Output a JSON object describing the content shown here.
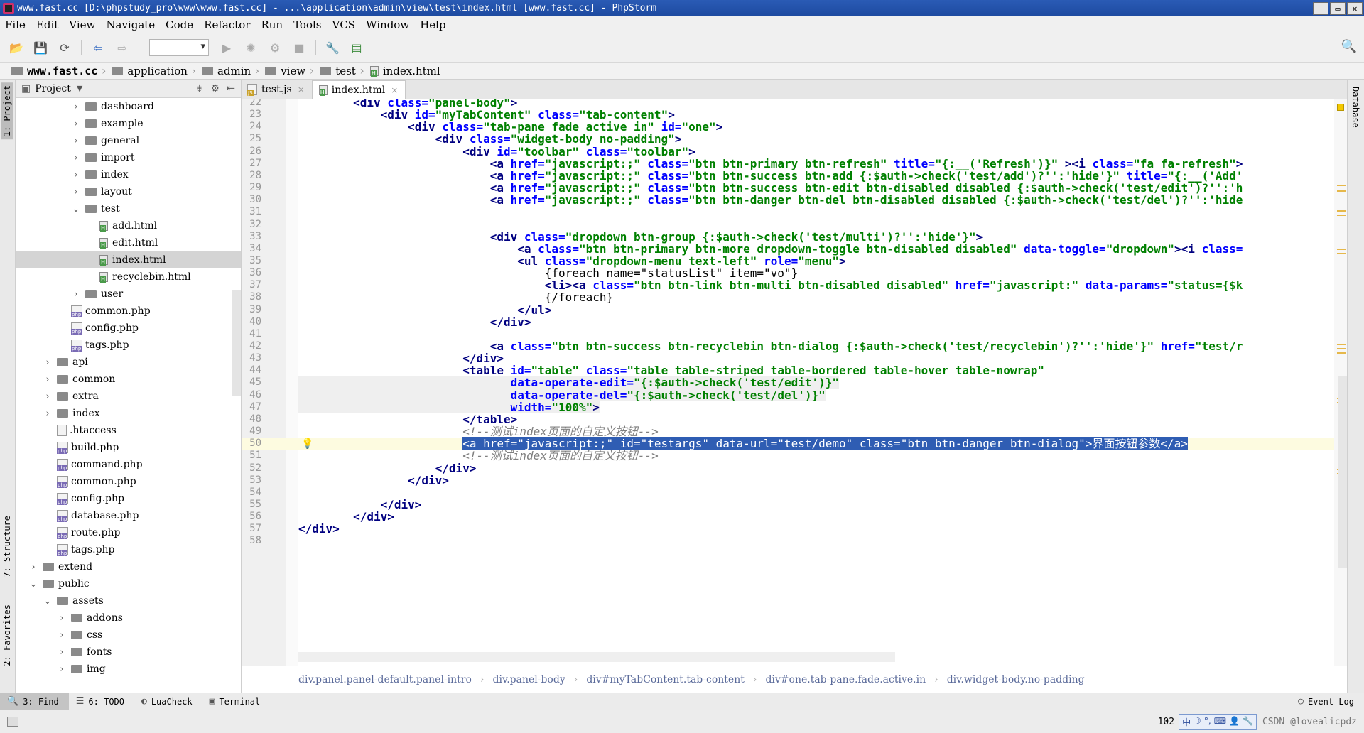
{
  "window": {
    "title": "www.fast.cc [D:\\phpstudy_pro\\www\\www.fast.cc] - ...\\application\\admin\\view\\test\\index.html [www.fast.cc] - PhpStorm",
    "min": "_",
    "max": "▭",
    "close": "✕"
  },
  "menu": [
    "File",
    "Edit",
    "View",
    "Navigate",
    "Code",
    "Refactor",
    "Run",
    "Tools",
    "VCS",
    "Window",
    "Help"
  ],
  "breadcrumbs": [
    "www.fast.cc",
    "application",
    "admin",
    "view",
    "test",
    "index.html"
  ],
  "project_panel": {
    "title": "Project",
    "tree": [
      {
        "label": "dashboard",
        "kind": "folder",
        "depth": 4,
        "expanded": false
      },
      {
        "label": "example",
        "kind": "folder",
        "depth": 4,
        "expanded": false
      },
      {
        "label": "general",
        "kind": "folder",
        "depth": 4,
        "expanded": false
      },
      {
        "label": "import",
        "kind": "folder",
        "depth": 4,
        "expanded": false
      },
      {
        "label": "index",
        "kind": "folder",
        "depth": 4,
        "expanded": false
      },
      {
        "label": "layout",
        "kind": "folder",
        "depth": 4,
        "expanded": false
      },
      {
        "label": "test",
        "kind": "folder",
        "depth": 4,
        "expanded": true
      },
      {
        "label": "add.html",
        "kind": "html",
        "depth": 5
      },
      {
        "label": "edit.html",
        "kind": "html",
        "depth": 5
      },
      {
        "label": "index.html",
        "kind": "html",
        "depth": 5,
        "selected": true
      },
      {
        "label": "recyclebin.html",
        "kind": "html",
        "depth": 5
      },
      {
        "label": "user",
        "kind": "folder",
        "depth": 4,
        "expanded": false
      },
      {
        "label": "common.php",
        "kind": "php",
        "depth": 3
      },
      {
        "label": "config.php",
        "kind": "php",
        "depth": 3
      },
      {
        "label": "tags.php",
        "kind": "php",
        "depth": 3
      },
      {
        "label": "api",
        "kind": "folder",
        "depth": 2,
        "expanded": false
      },
      {
        "label": "common",
        "kind": "folder",
        "depth": 2,
        "expanded": false
      },
      {
        "label": "extra",
        "kind": "folder",
        "depth": 2,
        "expanded": false
      },
      {
        "label": "index",
        "kind": "folder",
        "depth": 2,
        "expanded": false
      },
      {
        "label": ".htaccess",
        "kind": "plain",
        "depth": 2
      },
      {
        "label": "build.php",
        "kind": "php",
        "depth": 2
      },
      {
        "label": "command.php",
        "kind": "php",
        "depth": 2
      },
      {
        "label": "common.php",
        "kind": "php",
        "depth": 2
      },
      {
        "label": "config.php",
        "kind": "php",
        "depth": 2
      },
      {
        "label": "database.php",
        "kind": "php",
        "depth": 2
      },
      {
        "label": "route.php",
        "kind": "php",
        "depth": 2
      },
      {
        "label": "tags.php",
        "kind": "php",
        "depth": 2
      },
      {
        "label": "extend",
        "kind": "folder",
        "depth": 1,
        "expanded": false
      },
      {
        "label": "public",
        "kind": "folder",
        "depth": 1,
        "expanded": true
      },
      {
        "label": "assets",
        "kind": "folder",
        "depth": 2,
        "expanded": true
      },
      {
        "label": "addons",
        "kind": "folder",
        "depth": 3,
        "expanded": false
      },
      {
        "label": "css",
        "kind": "folder",
        "depth": 3,
        "expanded": false
      },
      {
        "label": "fonts",
        "kind": "folder",
        "depth": 3,
        "expanded": false
      },
      {
        "label": "img",
        "kind": "folder",
        "depth": 3,
        "expanded": false
      }
    ]
  },
  "left_tabs": [
    "1: Project",
    "7: Structure",
    "2: Favorites"
  ],
  "right_tabs": [
    "Database"
  ],
  "editor_tabs": [
    {
      "label": "test.js",
      "kind": "js",
      "active": false
    },
    {
      "label": "index.html",
      "kind": "html",
      "active": true
    }
  ],
  "code_lines": [
    {
      "n": "22",
      "html": "        <span class='tag'>&lt;div</span> <span class='attr'>class=</span><span class='val'>\"panel-body\"</span><span class='tag'>&gt;</span>"
    },
    {
      "n": "23",
      "html": "            <span class='tag'>&lt;div</span> <span class='attr'>id=</span><span class='val'>\"myTabContent\"</span> <span class='attr'>class=</span><span class='val'>\"tab-content\"</span><span class='tag'>&gt;</span>"
    },
    {
      "n": "24",
      "html": "                <span class='tag'>&lt;div</span> <span class='attr'>class=</span><span class='val'>\"tab-pane fade active in\"</span> <span class='attr'>id=</span><span class='val'>\"one\"</span><span class='tag'>&gt;</span>"
    },
    {
      "n": "25",
      "html": "                    <span class='tag'>&lt;div</span> <span class='attr'>class=</span><span class='val'>\"widget-body no-padding\"</span><span class='tag'>&gt;</span>"
    },
    {
      "n": "26",
      "html": "                        <span class='tag'>&lt;div</span> <span class='attr'>id=</span><span class='val'>\"toolbar\"</span> <span class='attr'>class=</span><span class='val'>\"toolbar\"</span><span class='tag'>&gt;</span>"
    },
    {
      "n": "27",
      "html": "                            <span class='tag'>&lt;a</span> <span class='attr'>href=</span><span class='val'>\"javascript:;\"</span> <span class='attr'>class=</span><span class='val'>\"btn btn-primary btn-refresh\"</span> <span class='attr'>title=</span><span class='val'>\"{:__('Refresh')}\"</span> <span class='tag'>&gt;&lt;i</span> <span class='attr'>class=</span><span class='val'>\"fa fa-refresh\"</span><span class='tag'>&gt;</span>"
    },
    {
      "n": "28",
      "html": "                            <span class='tag'>&lt;a</span> <span class='attr'>href=</span><span class='val'>\"javascript:;\"</span> <span class='attr'>class=</span><span class='val'>\"btn btn-success btn-add {:$auth-&gt;check('test/add')?'':'hide'}\"</span> <span class='attr'>title=</span><span class='val'>\"{:__('Add'</span>"
    },
    {
      "n": "29",
      "html": "                            <span class='tag'>&lt;a</span> <span class='attr'>href=</span><span class='val'>\"javascript:;\"</span> <span class='attr'>class=</span><span class='val'>\"btn btn-success btn-edit btn-disabled disabled {:$auth-&gt;check('test/edit')?'':'h</span>"
    },
    {
      "n": "30",
      "html": "                            <span class='tag'>&lt;a</span> <span class='attr'>href=</span><span class='val'>\"javascript:;\"</span> <span class='attr'>class=</span><span class='val'>\"btn btn-danger btn-del btn-disabled disabled {:$auth-&gt;check('test/del')?'':'hide</span>"
    },
    {
      "n": "31",
      "html": ""
    },
    {
      "n": "32",
      "html": ""
    },
    {
      "n": "33",
      "html": "                            <span class='tag'>&lt;div</span> <span class='attr'>class=</span><span class='val'>\"dropdown btn-group {:$auth-&gt;check('test/multi')?'':'hide'}\"</span><span class='tag'>&gt;</span>"
    },
    {
      "n": "34",
      "html": "                                <span class='tag'>&lt;a</span> <span class='attr'>class=</span><span class='val'>\"btn btn-primary btn-more dropdown-toggle btn-disabled disabled\"</span> <span class='attr'>data-toggle=</span><span class='val'>\"dropdown\"</span><span class='tag'>&gt;&lt;i</span> <span class='attr'>class=</span>"
    },
    {
      "n": "35",
      "html": "                                <span class='tag'>&lt;ul</span> <span class='attr'>class=</span><span class='val'>\"dropdown-menu text-left\"</span> <span class='attr'>role=</span><span class='val'>\"menu\"</span><span class='tag'>&gt;</span>"
    },
    {
      "n": "36",
      "html": "                                    <span class='tpl'>{foreach name=\"statusList\" item=\"vo\"}</span>"
    },
    {
      "n": "37",
      "html": "                                    <span class='tag'>&lt;li&gt;&lt;a</span> <span class='attr'>class=</span><span class='val'>\"btn btn-link btn-multi btn-disabled disabled\"</span> <span class='attr'>href=</span><span class='val'>\"javascript:\"</span> <span class='attr'>data-params=</span><span class='val'>\"status={$k</span>"
    },
    {
      "n": "38",
      "html": "                                    <span class='tpl'>{/foreach}</span>"
    },
    {
      "n": "39",
      "html": "                                <span class='tag'>&lt;/ul&gt;</span>"
    },
    {
      "n": "40",
      "html": "                            <span class='tag'>&lt;/div&gt;</span>"
    },
    {
      "n": "41",
      "html": ""
    },
    {
      "n": "42",
      "html": "                            <span class='tag'>&lt;a</span> <span class='attr'>class=</span><span class='val'>\"btn btn-success btn-recyclebin btn-dialog {:$auth-&gt;check('test/recyclebin')?'':'hide'}\"</span> <span class='attr'>href=</span><span class='val'>\"test/r</span>"
    },
    {
      "n": "43",
      "html": "                        <span class='tag'>&lt;/div&gt;</span>"
    },
    {
      "n": "44",
      "html": "                        <span class='tag'>&lt;table</span> <span class='attr'>id=</span><span class='val'>\"table\"</span> <span class='attr'>class=</span><span class='val'>\"table table-striped table-bordered table-hover table-nowrap\"</span>"
    },
    {
      "n": "45",
      "html": "                               <span class='attr'>data-operate-edit=</span><span class='val'>\"{:$auth-&gt;check('test/edit')}\"</span>"
    },
    {
      "n": "46",
      "html": "                               <span class='attr'>data-operate-del=</span><span class='val'>\"{:$auth-&gt;check('test/del')}\"</span>"
    },
    {
      "n": "47",
      "html": "                               <span class='attr'>width=</span><span class='val'>\"100%\"</span><span class='tag'>&gt;</span>"
    },
    {
      "n": "48",
      "html": "                        <span class='tag'>&lt;/table&gt;</span>"
    },
    {
      "n": "49",
      "html": "                        <span class='cmt'>&lt;!--测试index页面的自定义按钮--&gt;</span>"
    },
    {
      "n": "50",
      "html": "                        <span class='sel'>&lt;a href=\"javascript:;\" id=\"testargs\" data-url=\"test/demo\" class=\"btn btn-danger btn-dialog\"&gt;界面按钮参数&lt;/a&gt;</span>"
    },
    {
      "n": "51",
      "html": "                        <span class='cmt'>&lt;!--测试index页面的自定义按钮--&gt;</span>"
    },
    {
      "n": "52",
      "html": "                    <span class='tag'>&lt;/div&gt;</span>"
    },
    {
      "n": "53",
      "html": "                <span class='tag'>&lt;/div&gt;</span>"
    },
    {
      "n": "54",
      "html": ""
    },
    {
      "n": "55",
      "html": "            <span class='tag'>&lt;/div&gt;</span>"
    },
    {
      "n": "56",
      "html": "        <span class='tag'>&lt;/div&gt;</span>"
    },
    {
      "n": "57",
      "html": "<span class='tag'>&lt;/div&gt;</span>"
    },
    {
      "n": "58",
      "html": ""
    }
  ],
  "editor_breadcrumb": [
    "div.panel.panel-default.panel-intro",
    "div.panel-body",
    "div#myTabContent.tab-content",
    "div#one.tab-pane.fade.active.in",
    "div.widget-body.no-padding"
  ],
  "bottom_tools": [
    {
      "label": "3: Find",
      "icon": "search-icon",
      "glyph": "🔍",
      "active": true
    },
    {
      "label": "6: TODO",
      "icon": "todo-icon",
      "glyph": "☰",
      "active": false
    },
    {
      "label": "LuaCheck",
      "icon": "luacheck-icon",
      "glyph": "◐",
      "active": false
    },
    {
      "label": "Terminal",
      "icon": "terminal-icon",
      "glyph": "▣",
      "active": false
    }
  ],
  "event_log": "Event Log",
  "status": {
    "position": "102",
    "ime": [
      "中",
      "☽",
      "°,",
      "⌨",
      "👤",
      "🔧"
    ],
    "watermark": "CSDN @lovealicpdz"
  },
  "colors": {
    "selection": "#2f5db3",
    "tag": "#000080",
    "attr": "#0000ff",
    "value": "#008000",
    "comment": "#808080"
  }
}
